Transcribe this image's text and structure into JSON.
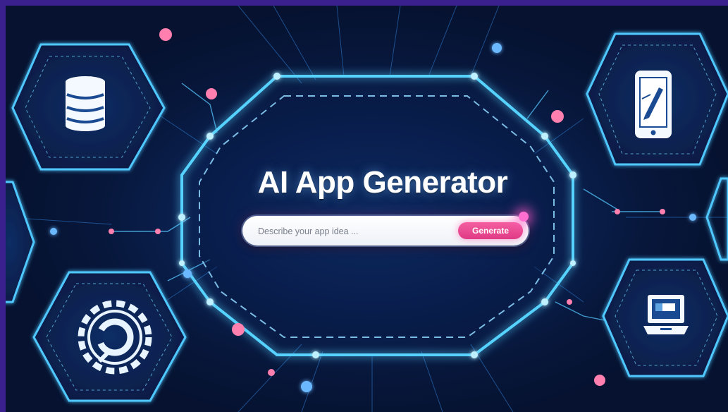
{
  "hero": {
    "title": "AI App Generator"
  },
  "prompt_bar": {
    "placeholder": "Describe your app idea ...",
    "value": "",
    "button_label": "Generate"
  },
  "icons": {
    "top_left": "database-icon",
    "bottom_left": "gear-icon",
    "top_right": "smartphone-edit-icon",
    "bottom_right": "laptop-icon"
  },
  "colors": {
    "background_dark": "#07173b",
    "neon_cyan": "#4fd0ff",
    "accent_pink": "#e03a86",
    "frame_purple": "#3a1f8f"
  }
}
